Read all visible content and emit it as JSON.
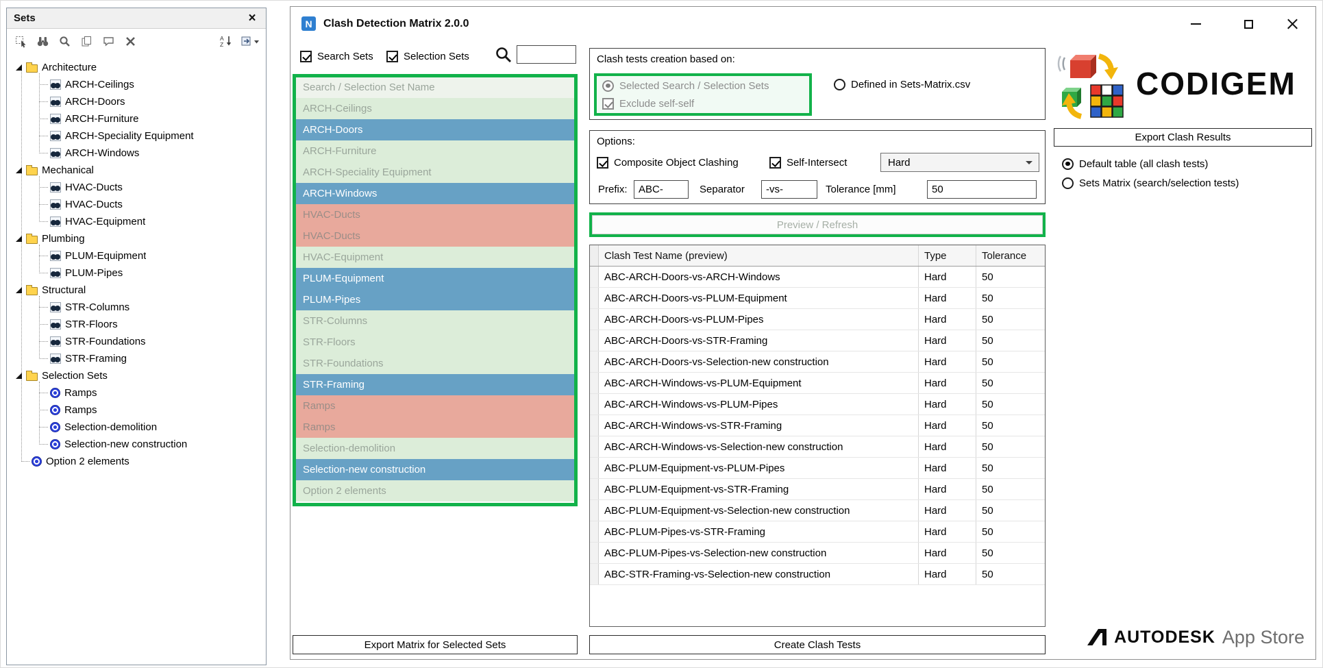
{
  "colors": {
    "annotation_green": "#12b24a",
    "row_states": {
      "available": {
        "bg": "#dcedd9",
        "text": "#9aa69b"
      },
      "selected": {
        "bg": "#67a1c5",
        "text": "#ffffff"
      },
      "excluded": {
        "bg": "#e8a99c",
        "text": "#9a8d87"
      }
    }
  },
  "icons": [
    "close-icon",
    "search-icon",
    "minimize-icon",
    "maximize-icon",
    "folder-icon",
    "search-set-icon",
    "selection-set-icon",
    "expander-icon",
    "dropdown-caret-icon",
    "codigem-icon",
    "autodesk-icon"
  ],
  "sets_panel": {
    "title": "Sets",
    "toolbar_icons": [
      "select-set-icon",
      "find-items-icon",
      "quick-find-icon",
      "duplicate-icon",
      "comment-icon",
      "delete-icon",
      "sort-icon",
      "import-export-icon"
    ],
    "tree": [
      {
        "label": "Architecture",
        "children": [
          {
            "label": "ARCH-Ceilings",
            "icon": "search"
          },
          {
            "label": "ARCH-Doors",
            "icon": "search"
          },
          {
            "label": "ARCH-Furniture",
            "icon": "search"
          },
          {
            "label": "ARCH-Speciality Equipment",
            "icon": "search"
          },
          {
            "label": "ARCH-Windows",
            "icon": "search"
          }
        ]
      },
      {
        "label": "Mechanical",
        "children": [
          {
            "label": "HVAC-Ducts",
            "icon": "search"
          },
          {
            "label": "HVAC-Ducts",
            "icon": "search"
          },
          {
            "label": "HVAC-Equipment",
            "icon": "search"
          }
        ]
      },
      {
        "label": "Plumbing",
        "children": [
          {
            "label": "PLUM-Equipment",
            "icon": "search"
          },
          {
            "label": "PLUM-Pipes",
            "icon": "search"
          }
        ]
      },
      {
        "label": "Structural",
        "children": [
          {
            "label": "STR-Columns",
            "icon": "search"
          },
          {
            "label": "STR-Floors",
            "icon": "search"
          },
          {
            "label": "STR-Foundations",
            "icon": "search"
          },
          {
            "label": "STR-Framing",
            "icon": "search"
          }
        ]
      },
      {
        "label": "Selection Sets",
        "children": [
          {
            "label": "Ramps",
            "icon": "selection"
          },
          {
            "label": "Ramps",
            "icon": "selection"
          },
          {
            "label": "Selection-demolition",
            "icon": "selection"
          },
          {
            "label": "Selection-new construction",
            "icon": "selection"
          }
        ]
      },
      {
        "label": "Option 2 elements",
        "icon": "selection"
      }
    ]
  },
  "dialog": {
    "title": "Clash Detection Matrix 2.0.0",
    "app_icon_letter": "N",
    "filters": {
      "search_sets_label": "Search Sets",
      "selection_sets_label": "Selection Sets",
      "search_value": ""
    },
    "set_list": {
      "header": "Search / Selection Set Name",
      "rows": [
        {
          "name": "ARCH-Ceilings",
          "state": "available"
        },
        {
          "name": "ARCH-Doors",
          "state": "selected"
        },
        {
          "name": "ARCH-Furniture",
          "state": "available"
        },
        {
          "name": "ARCH-Speciality Equipment",
          "state": "available"
        },
        {
          "name": "ARCH-Windows",
          "state": "selected"
        },
        {
          "name": "HVAC-Ducts",
          "state": "excluded"
        },
        {
          "name": "HVAC-Ducts",
          "state": "excluded"
        },
        {
          "name": "HVAC-Equipment",
          "state": "available"
        },
        {
          "name": "PLUM-Equipment",
          "state": "selected"
        },
        {
          "name": "PLUM-Pipes",
          "state": "selected"
        },
        {
          "name": "STR-Columns",
          "state": "available"
        },
        {
          "name": "STR-Floors",
          "state": "available"
        },
        {
          "name": "STR-Foundations",
          "state": "available"
        },
        {
          "name": "STR-Framing",
          "state": "selected"
        },
        {
          "name": "Ramps",
          "state": "excluded"
        },
        {
          "name": "Ramps",
          "state": "excluded"
        },
        {
          "name": "Selection-demolition",
          "state": "available"
        },
        {
          "name": "Selection-new construction",
          "state": "selected"
        },
        {
          "name": "Option 2 elements",
          "state": "available"
        }
      ]
    },
    "export_matrix_button": "Export Matrix for Selected Sets",
    "creation_group": {
      "title": "Clash tests creation based on:",
      "radio_selected_sets": "Selected Search / Selection Sets",
      "checkbox_exclude_self": "Exclude self-self",
      "radio_csv": "Defined in Sets-Matrix.csv"
    },
    "options_group": {
      "title": "Options:",
      "composite_label": "Composite Object Clashing",
      "self_intersect_label": "Self-Intersect",
      "clash_type_value": "Hard",
      "prefix_label": "Prefix:",
      "prefix_value": "ABC-",
      "separator_label": "Separator",
      "separator_value": "-vs-",
      "tolerance_label": "Tolerance [mm]",
      "tolerance_value": "50"
    },
    "preview_button": "Preview / Refresh",
    "table": {
      "headers": [
        "Clash Test Name (preview)",
        "Type",
        "Tolerance"
      ],
      "rows": [
        [
          "ABC-ARCH-Doors-vs-ARCH-Windows",
          "Hard",
          "50"
        ],
        [
          "ABC-ARCH-Doors-vs-PLUM-Equipment",
          "Hard",
          "50"
        ],
        [
          "ABC-ARCH-Doors-vs-PLUM-Pipes",
          "Hard",
          "50"
        ],
        [
          "ABC-ARCH-Doors-vs-STR-Framing",
          "Hard",
          "50"
        ],
        [
          "ABC-ARCH-Doors-vs-Selection-new construction",
          "Hard",
          "50"
        ],
        [
          "ABC-ARCH-Windows-vs-PLUM-Equipment",
          "Hard",
          "50"
        ],
        [
          "ABC-ARCH-Windows-vs-PLUM-Pipes",
          "Hard",
          "50"
        ],
        [
          "ABC-ARCH-Windows-vs-STR-Framing",
          "Hard",
          "50"
        ],
        [
          "ABC-ARCH-Windows-vs-Selection-new construction",
          "Hard",
          "50"
        ],
        [
          "ABC-PLUM-Equipment-vs-PLUM-Pipes",
          "Hard",
          "50"
        ],
        [
          "ABC-PLUM-Equipment-vs-STR-Framing",
          "Hard",
          "50"
        ],
        [
          "ABC-PLUM-Equipment-vs-Selection-new construction",
          "Hard",
          "50"
        ],
        [
          "ABC-PLUM-Pipes-vs-STR-Framing",
          "Hard",
          "50"
        ],
        [
          "ABC-PLUM-Pipes-vs-Selection-new construction",
          "Hard",
          "50"
        ],
        [
          "ABC-STR-Framing-vs-Selection-new construction",
          "Hard",
          "50"
        ]
      ]
    },
    "create_button": "Create Clash Tests"
  },
  "right_panel": {
    "brand": "CODIGEM",
    "export_results_button": "Export Clash Results",
    "radio_default_table": "Default table (all clash tests)",
    "radio_sets_matrix": "Sets Matrix (search/selection tests)",
    "autodesk_label": "AUTODESK",
    "app_store_label": "App Store"
  }
}
